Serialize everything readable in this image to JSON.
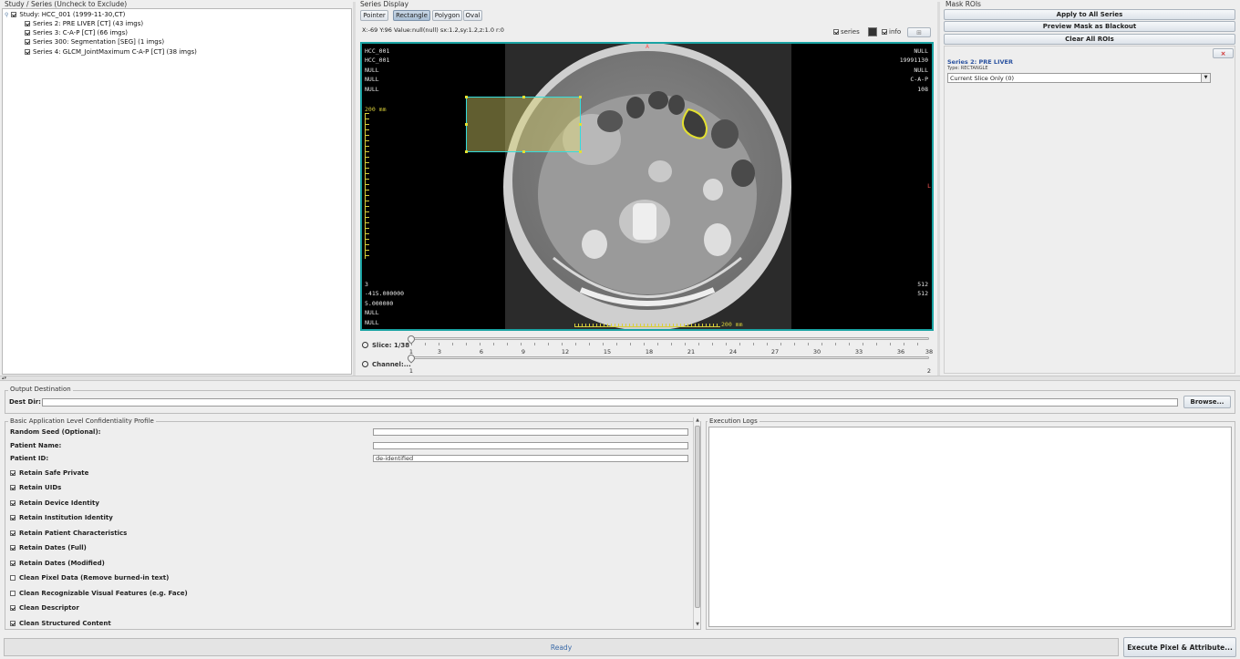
{
  "tree": {
    "title": "Study / Series (Uncheck to Exclude)",
    "study": "Study: HCC_001 (1999-11-30,CT)",
    "series": [
      "Series 2: PRE LIVER [CT] (43 imgs)",
      "Series 3: C-A-P [CT] (66 imgs)",
      "Series 300: Segmentation [SEG] (1 imgs)",
      "Series 4: GLCM_JointMaximum C-A-P [CT] (38 imgs)"
    ]
  },
  "display": {
    "title": "Series Display",
    "tools": [
      "Pointer",
      "Rectangle",
      "Polygon",
      "Oval"
    ],
    "active_tool": "Rectangle",
    "status": "X:-69 Y:96 Value:null(null) sx:1.2,sy:1.2,z:1.0 r:0",
    "series_label": "series",
    "info_label": "info",
    "overlay": {
      "top_left": [
        "HCC_001",
        "HCC_001",
        "NULL",
        "NULL",
        "NULL"
      ],
      "top_right": [
        "NULL",
        "19991130",
        "NULL",
        "C-A-P",
        "108"
      ],
      "bottom_left": [
        "3",
        "-415.000000",
        "5.000000",
        "NULL",
        "NULL"
      ],
      "bottom_right": [
        "512",
        "512"
      ],
      "ruler_v": "200 mm",
      "ruler_h": "200 mm",
      "orient_top": "A",
      "orient_right": "L"
    },
    "slice": {
      "label": "Slice: 1/38",
      "ticks": [
        "1",
        "3",
        "6",
        "9",
        "12",
        "15",
        "18",
        "21",
        "24",
        "27",
        "30",
        "33",
        "36",
        "38"
      ],
      "value": 1,
      "max": 38
    },
    "channel": {
      "label": "Channel:...",
      "ticks": [
        "1",
        "2"
      ],
      "value": 1,
      "max": 2
    }
  },
  "roi": {
    "title": "Mask ROIs",
    "apply": "Apply to All Series",
    "preview": "Preview Mask as Blackout",
    "clear": "Clear All ROIs",
    "entry": {
      "series": "Series 2: PRE LIVER",
      "type": "Type: RECTANGLE",
      "scope": "Current Slice Only (0)",
      "remove": "×"
    }
  },
  "output": {
    "title": "Output Destination",
    "dest_label": "Dest Dir:",
    "dest_value": "",
    "browse": "Browse..."
  },
  "profile": {
    "title": "Basic Application Level Confidentiality Profile",
    "fields": [
      {
        "label": "Random Seed (Optional):",
        "value": ""
      },
      {
        "label": "Patient Name:",
        "value": ""
      },
      {
        "label": "Patient ID:",
        "value": "de-identified"
      }
    ],
    "options": [
      {
        "label": "Retain Safe Private",
        "checked": true
      },
      {
        "label": "Retain UIDs",
        "checked": true
      },
      {
        "label": "Retain Device Identity",
        "checked": true
      },
      {
        "label": "Retain Institution Identity",
        "checked": true
      },
      {
        "label": "Retain Patient Characteristics",
        "checked": true
      },
      {
        "label": "Retain Dates (Full)",
        "checked": true
      },
      {
        "label": "Retain Dates (Modified)",
        "checked": true
      },
      {
        "label": "Clean Pixel Data (Remove burned-in text)",
        "checked": false
      },
      {
        "label": "Clean Recognizable Visual Features (e.g. Face)",
        "checked": false
      },
      {
        "label": "Clean Descriptor",
        "checked": true
      },
      {
        "label": "Clean Structured Content",
        "checked": true
      }
    ]
  },
  "logs": {
    "title": "Execution Logs"
  },
  "status": {
    "text": "Ready",
    "execute": "Execute Pixel & Attribute..."
  },
  "colors": {
    "accent": "#2a52a0",
    "roi_border": "#33dddd",
    "roi_fill": "#d8d06a",
    "ruler": "#d8cf3a",
    "viewport_border": "#1aa3a3"
  }
}
